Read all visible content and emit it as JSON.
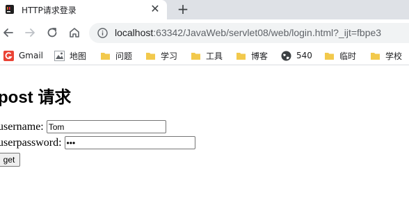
{
  "tab": {
    "title": "HTTP请求登录",
    "close_glyph": "✕",
    "new_tab_glyph": "+"
  },
  "toolbar": {
    "url_host": "localhost",
    "url_rest": ":63342/JavaWeb/servlet08/web/login.html?_ijt=fbpe3"
  },
  "bookmarks": [
    {
      "label": "Gmail",
      "icon": "gmail-icon"
    },
    {
      "label": "地图",
      "icon": "maps-icon"
    },
    {
      "label": "问题",
      "icon": "folder-icon"
    },
    {
      "label": "学习",
      "icon": "folder-icon"
    },
    {
      "label": "工具",
      "icon": "folder-icon"
    },
    {
      "label": "博客",
      "icon": "folder-icon"
    },
    {
      "label": "540",
      "icon": "globe-icon"
    },
    {
      "label": "临时",
      "icon": "folder-icon"
    },
    {
      "label": "学校",
      "icon": "folder-icon"
    }
  ],
  "page": {
    "heading": "post 请求",
    "username_label": "username:",
    "username_value": "Tom",
    "password_label": "userpassword:",
    "password_value": "•••",
    "submit_label": "get"
  },
  "colors": {
    "tabstrip": "#dee1e6",
    "omnibox": "#f1f3f4",
    "folder": "#f2c94c",
    "gmail": "#ea4335"
  }
}
